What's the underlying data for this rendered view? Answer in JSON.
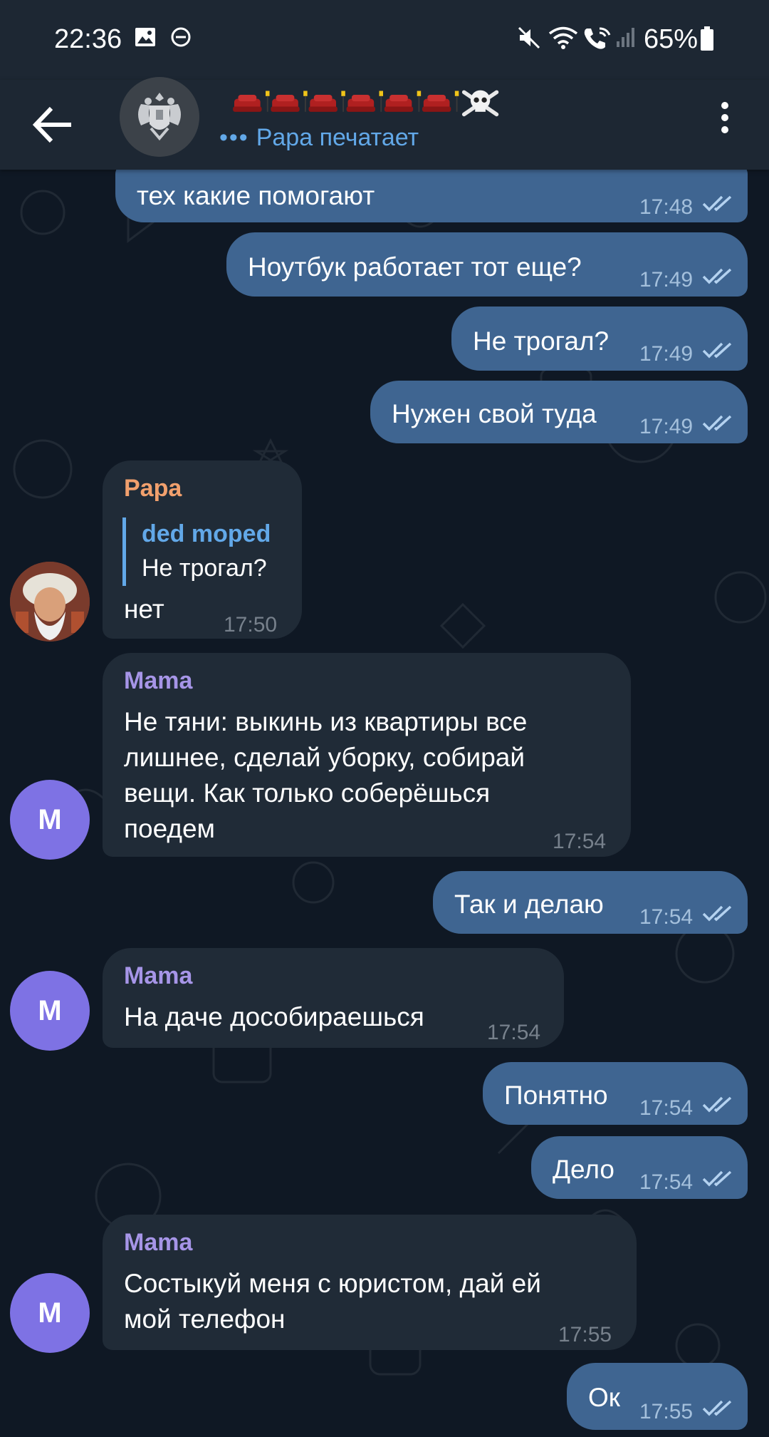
{
  "status_bar": {
    "time": "22:36",
    "battery": "65%",
    "icons": [
      "gallery-icon",
      "dnd-icon",
      "mute-icon",
      "wifi-icon",
      "wifi-calling-icon",
      "signal-icon",
      "battery-icon"
    ]
  },
  "header": {
    "title_icons": [
      "sofa-icon",
      "lamp-icon",
      "sofa-icon",
      "lamp-icon",
      "sofa-icon",
      "lamp-icon",
      "sofa-icon",
      "lamp-icon",
      "sofa-icon",
      "lamp-icon",
      "sofa-icon",
      "lamp-icon",
      "skull-crossbones-icon"
    ],
    "typing_status": "Papa печатает",
    "avatar": "coat-of-arms-icon"
  },
  "messages": [
    {
      "dir": "out",
      "text": "тех какие помогают",
      "time": "17:48",
      "read": true
    },
    {
      "dir": "out",
      "text": "Ноутбук работает тот еще?",
      "time": "17:49",
      "read": true
    },
    {
      "dir": "out",
      "text": "Не трогал?",
      "time": "17:49",
      "read": true
    },
    {
      "dir": "out",
      "text": "Нужен свой туда",
      "time": "17:49",
      "read": true
    },
    {
      "dir": "in",
      "sender": "Papa",
      "reply_to": {
        "name": "ded moped",
        "text": "Не трогал?"
      },
      "text": "нет",
      "time": "17:50"
    },
    {
      "dir": "in",
      "sender": "Mama",
      "lines": [
        "Не тяни: выкинь из квартиры все",
        "лишнее, сделай уборку, собирай",
        "вещи. Как только соберёшься",
        "поедем"
      ],
      "time": "17:54",
      "avatar_letter": "M"
    },
    {
      "dir": "out",
      "text": "Так и делаю",
      "time": "17:54",
      "read": true
    },
    {
      "dir": "in",
      "sender": "Mama",
      "text": "На даче дособираешься",
      "time": "17:54",
      "avatar_letter": "M"
    },
    {
      "dir": "out",
      "text": "Понятно",
      "time": "17:54",
      "read": true
    },
    {
      "dir": "out",
      "text": "Дело",
      "time": "17:54",
      "read": true
    },
    {
      "dir": "in",
      "sender": "Mama",
      "lines": [
        "Состыкуй меня с юристом, дай ей",
        "мой телефон"
      ],
      "time": "17:55",
      "avatar_letter": "M"
    },
    {
      "dir": "out",
      "text": "Ок",
      "time": "17:55",
      "read": true
    }
  ],
  "colors": {
    "outgoing_bubble": "#3f6591",
    "incoming_bubble": "#202b37",
    "background": "#0f1824",
    "header": "#1d2733",
    "accent_blue": "#62a8e8",
    "papa_name": "#f1a06d",
    "mama_name": "#a695e7",
    "avatar_mama": "#7e72e4"
  }
}
